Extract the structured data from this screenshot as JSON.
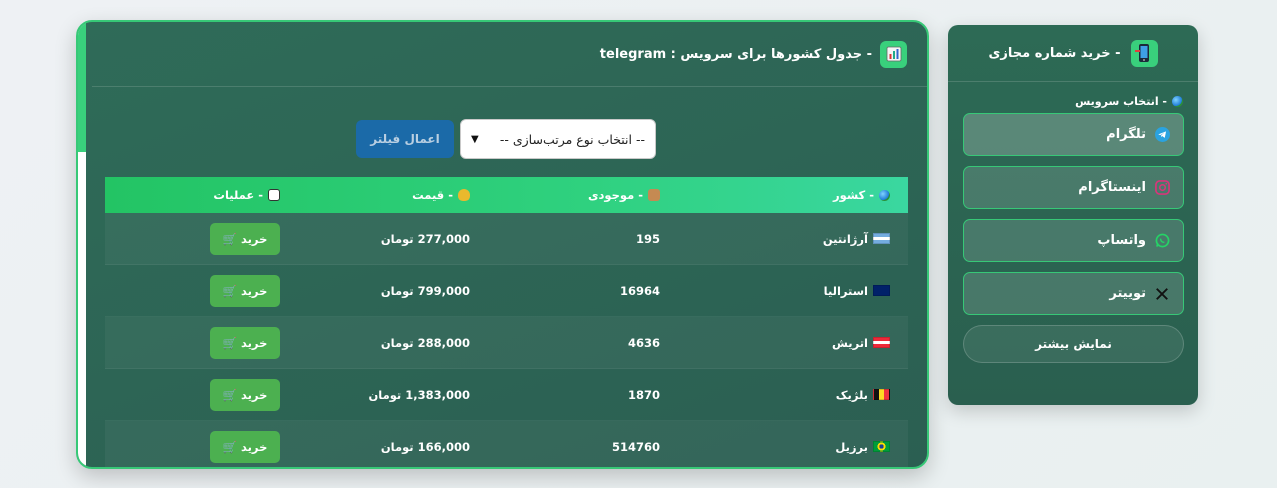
{
  "sidebar": {
    "title": "- خرید شماره مجازی",
    "section_label": "- انتخاب سرویس",
    "services": [
      {
        "label": "تلگرام",
        "icon": "telegram-icon",
        "color": "#2aa3e0"
      },
      {
        "label": "اینستاگرام",
        "icon": "instagram-icon",
        "color": "#d8357a"
      },
      {
        "label": "واتساپ",
        "icon": "whatsapp-icon",
        "color": "#25d366"
      },
      {
        "label": "توییتر",
        "icon": "x-icon",
        "color": "#111111"
      }
    ],
    "more_label": "نمایش بیشتر"
  },
  "main": {
    "title": "- جدول کشورها برای سرویس : telegram",
    "filter_button": "اعمال فیلتر",
    "sort_select": "-- انتخاب نوع مرتب‌سازی --",
    "columns": {
      "country": "- کشور",
      "stock": "- موجودی",
      "price": "- قیمت",
      "ops": "- عملیات"
    },
    "buy_label": "خرید",
    "rows": [
      {
        "country": "آرژانتین",
        "flag": "ar",
        "stock": "195",
        "price": "277,000 تومان"
      },
      {
        "country": "استرالیا",
        "flag": "au",
        "stock": "16964",
        "price": "799,000 تومان"
      },
      {
        "country": "اتریش",
        "flag": "at",
        "stock": "4636",
        "price": "288,000 تومان"
      },
      {
        "country": "بلژیک",
        "flag": "be",
        "stock": "1870",
        "price": "1,383,000 تومان"
      },
      {
        "country": "برزیل",
        "flag": "br",
        "stock": "514760",
        "price": "166,000 تومان"
      }
    ]
  },
  "colors": {
    "card_bg": "#2d6a55",
    "accent_green": "#37c877",
    "buy_button": "#4cb050",
    "filter_button": "#1b6aa8"
  }
}
